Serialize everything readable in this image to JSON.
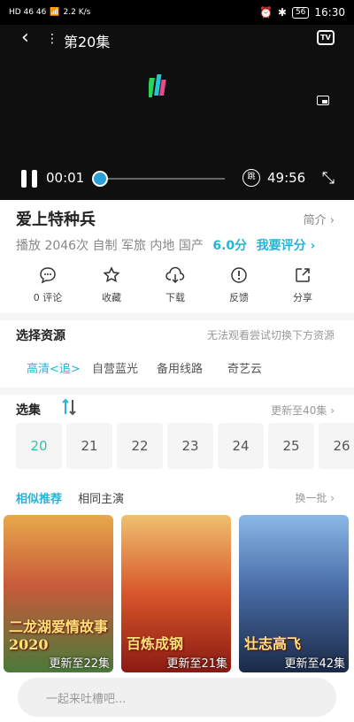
{
  "status": {
    "signal_left": "HD 46 46 ",
    "speed": "2.2 K/s",
    "battery": "56",
    "time": "16:30"
  },
  "player": {
    "episode_title": "第20集",
    "tv_label": "TV",
    "current_time": "00:01",
    "total_time": "49:56",
    "skip_label": "跳",
    "progress": 0.0
  },
  "show": {
    "title": "爱上特种兵",
    "intro_label": "简介 ›",
    "meta_text": "播放 2046次  自制 军旅 内地 国产",
    "score": "6.0分",
    "rate_label": "我要评分 ›"
  },
  "actions": [
    {
      "label": "0 评论",
      "icon": "comment-icon"
    },
    {
      "label": "收藏",
      "icon": "star-icon"
    },
    {
      "label": "下载",
      "icon": "download-icon"
    },
    {
      "label": "反馈",
      "icon": "feedback-icon"
    },
    {
      "label": "分享",
      "icon": "share-icon"
    }
  ],
  "sources_section": {
    "title": "选择资源",
    "hint": "无法观看尝试切换下方资源",
    "items": [
      "高清<追>",
      "自营蓝光",
      "备用线路",
      "奇艺云"
    ]
  },
  "episodes_section": {
    "title": "选集",
    "update_label": "更新至40集 ›",
    "items": [
      "20",
      "21",
      "22",
      "23",
      "24",
      "25",
      "26"
    ]
  },
  "recommend": {
    "tab_similar": "相似推荐",
    "tab_cast": "相同主演",
    "refresh": "换一批 ›",
    "posters": [
      {
        "title": "二龙湖爱情故事2020",
        "update": "更新至22集",
        "color_top": "#e8a84a",
        "color_bottom": "#4a7a3a"
      },
      {
        "title": "百炼成钢",
        "update": "更新至21集",
        "color_top": "#d8562a",
        "color_bottom": "#8a1a12"
      },
      {
        "title": "壮志高飞",
        "update": "更新至42集",
        "color_top": "#6a9ed8",
        "color_bottom": "#1a2a48"
      }
    ]
  },
  "comment_placeholder": "一起来吐槽吧..."
}
